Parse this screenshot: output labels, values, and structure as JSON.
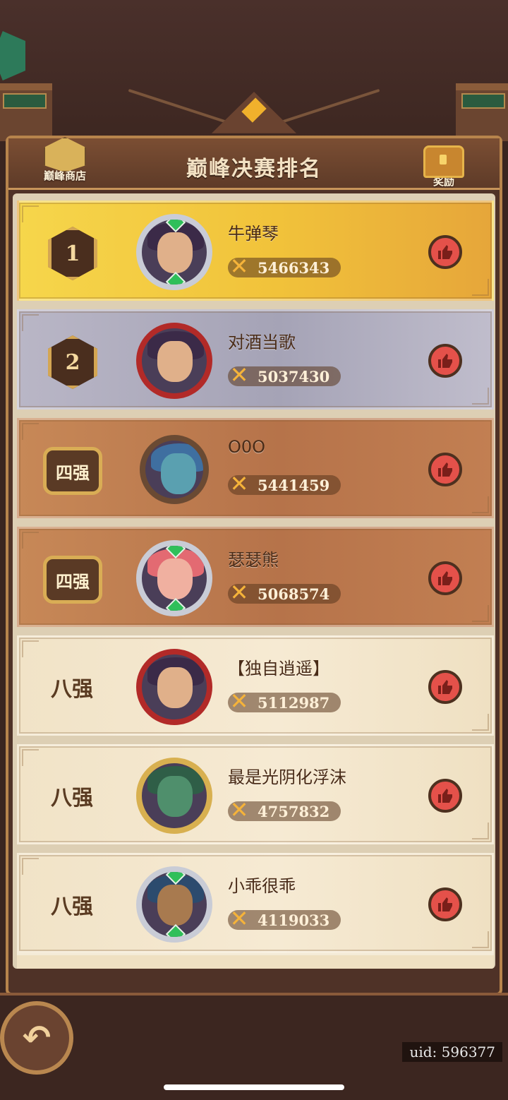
{
  "header": {
    "title": "巅峰决赛排名",
    "shop_label": "巅峰商店",
    "reward_label": "奖励"
  },
  "rankings": [
    {
      "rank": "1",
      "rank_type": "medal",
      "name": "牛弹琴",
      "score": "5466343",
      "style": "gold"
    },
    {
      "rank": "2",
      "rank_type": "medal",
      "name": "对酒当歌",
      "score": "5037430",
      "style": "silver"
    },
    {
      "rank": "四强",
      "rank_type": "badge",
      "name": "O0O",
      "score": "5441459",
      "style": "bronze"
    },
    {
      "rank": "四强",
      "rank_type": "badge",
      "name": "瑟瑟熊",
      "score": "5068574",
      "style": "bronze"
    },
    {
      "rank": "八强",
      "rank_type": "text",
      "name": "【独自逍遥】",
      "score": "5112987",
      "style": "plain"
    },
    {
      "rank": "八强",
      "rank_type": "text",
      "name": "最是光阴化浮沫",
      "score": "4757832",
      "style": "plain"
    },
    {
      "rank": "八强",
      "rank_type": "text",
      "name": "小乖很乖",
      "score": "4119033",
      "style": "plain"
    }
  ],
  "footer": {
    "uid": "uid: 596377"
  },
  "icons": {
    "shop": "treasure-pile-icon",
    "reward": "treasure-chest-icon",
    "like": "thumbs-up-icon",
    "score": "crossed-swords-icon",
    "back": "back-arrow-icon"
  }
}
